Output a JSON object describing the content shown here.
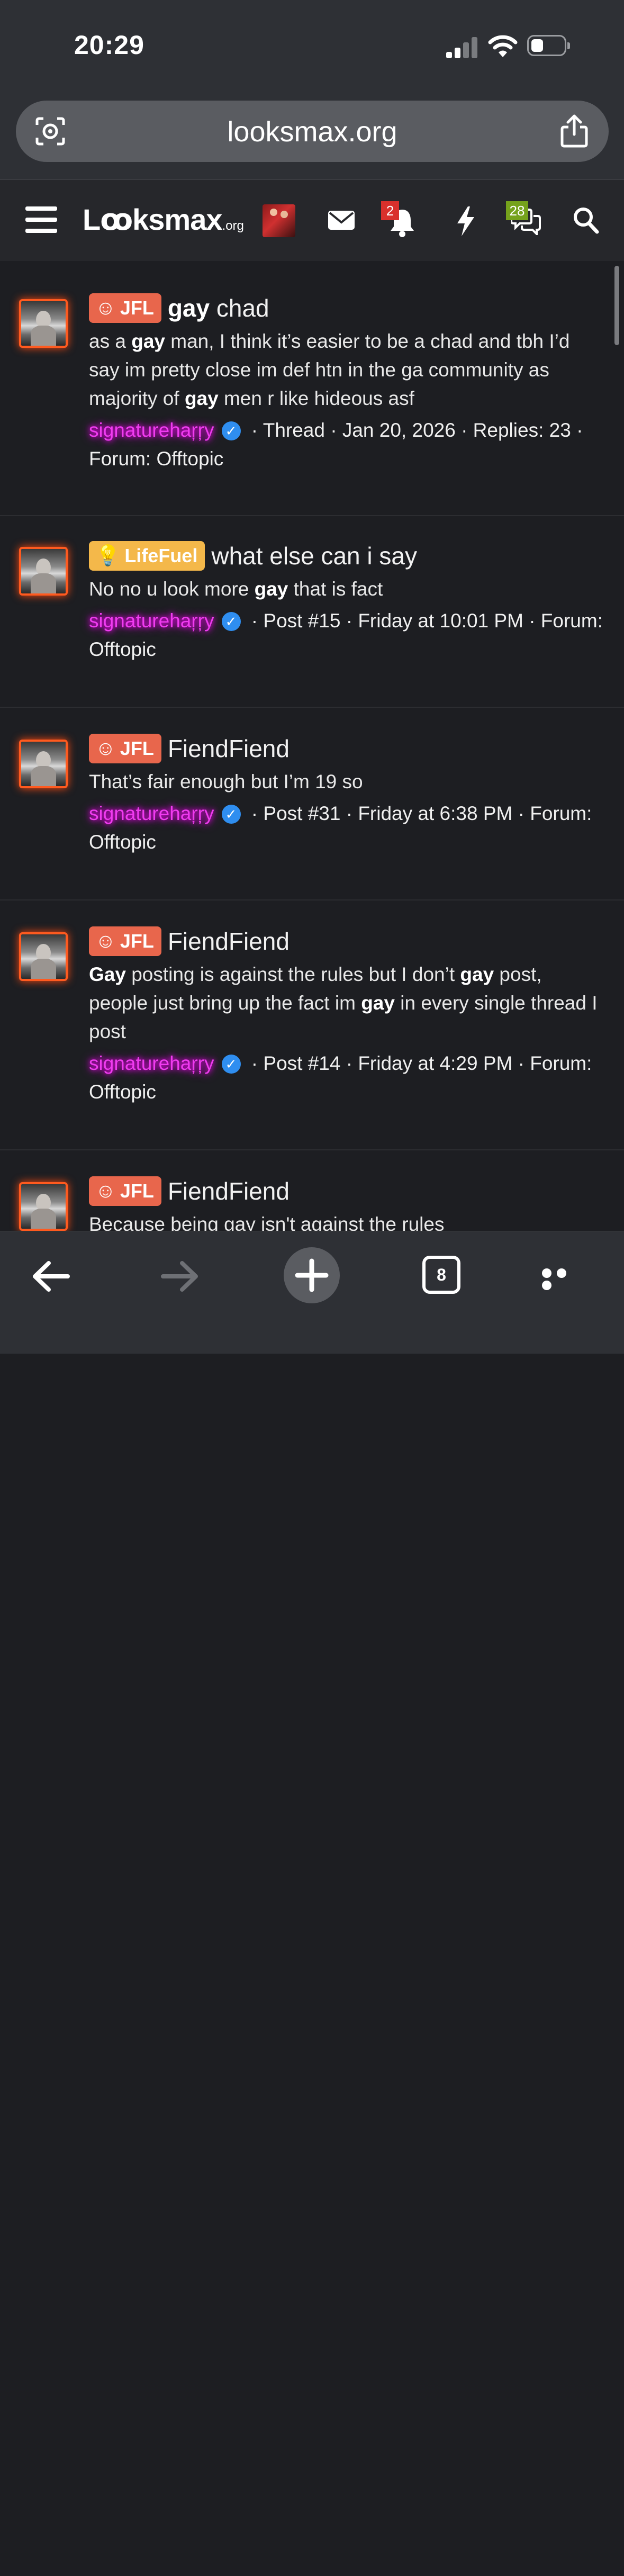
{
  "status": {
    "time": "20:29"
  },
  "browser": {
    "url": "looksmax.org",
    "tab_count": "8"
  },
  "site": {
    "logo_main": "Lꝏksmax",
    "logo_suffix": ".org",
    "notifications_badge": "2",
    "conversations_badge": "28"
  },
  "results": [
    {
      "prefix": "JFL",
      "prefix_style": "jfl",
      "title_bold": "gay",
      "title_rest": " chad",
      "snippet_html": "as a <b>gay</b> man, I think it’s easier to be a chad and tbh I’d say im pretty close im def htn in the ga community as majority of <b>gay</b> men r like hideous asf",
      "author": "signaturehaŗŗy",
      "meta": " · Thread · Jan 20, 2026 · Replies: 23 · Forum: Offtopic"
    },
    {
      "prefix": "LifeFuel",
      "prefix_style": "lf",
      "title_bold": "",
      "title_rest": "what else can i say",
      "snippet_html": "No no u look more <b>gay</b> that is fact",
      "author": "signaturehaŗŗy",
      "meta": " · Post #15 · Friday at 10:01 PM · Forum: Offtopic"
    },
    {
      "prefix": "JFL",
      "prefix_style": "jfl",
      "title_bold": "",
      "title_rest": "FiendFiend",
      "snippet_html": "That’s fair enough but I’m 19 so",
      "author": "signaturehaŗŗy",
      "meta": " · Post #31 · Friday at 6:38 PM · Forum: Offtopic"
    },
    {
      "prefix": "JFL",
      "prefix_style": "jfl",
      "title_bold": "",
      "title_rest": "FiendFiend",
      "snippet_html": "<b>Gay</b> posting is against the rules but I don’t <b>gay</b> post, people just bring up the fact im <b>gay</b> in every single thread I post",
      "author": "signaturehaŗŗy",
      "meta": " · Post #14 · Friday at 4:29 PM · Forum: Offtopic"
    },
    {
      "prefix": "JFL",
      "prefix_style": "jfl",
      "title_bold": "",
      "title_rest": "FiendFiend",
      "snippet_html": "Because being gay isn't against the rules",
      "author": "",
      "meta": ""
    }
  ],
  "icons": {
    "lens": "camera-lens-icon",
    "share": "share-icon",
    "menu": "hamburger-icon",
    "mail": "mail-icon",
    "bell": "bell-icon",
    "bolt": "lightning-icon",
    "chat": "chat-bubbles-icon",
    "search": "search-icon",
    "back": "arrow-left-icon",
    "forward": "arrow-right-icon",
    "newtab": "plus-icon",
    "more": "ellipsis-icon"
  },
  "colors": {
    "prefix_jfl": "#e8664c",
    "prefix_lifefuel": "#f4b84a",
    "username": "#f03cf0",
    "avatar_border": "#ff5a1f"
  }
}
